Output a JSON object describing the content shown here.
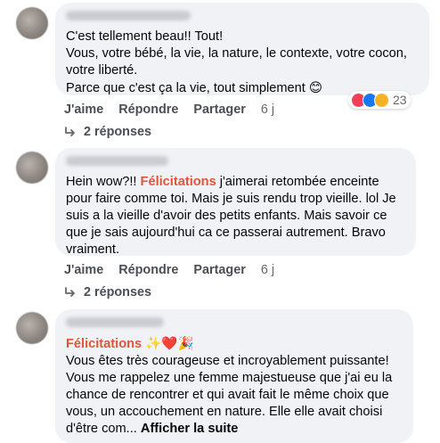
{
  "comments": [
    {
      "text": "C'est tellement beau!! Tout!\nVous, votre bébé, la vie, la nature, le contexte, votre cocon, votre liberté.\nParce que c'est ça la vie, tout simplement",
      "emoji": "😊",
      "reactions": {
        "icons": [
          "heart-reaction-icon",
          "like-reaction-icon",
          "care-reaction-icon"
        ],
        "count": "23"
      },
      "actions": {
        "like": "J'aime",
        "reply": "Répondre",
        "share": "Partager",
        "time": "6 j"
      },
      "replies": "2 réponses"
    },
    {
      "text_before": "Hein wow?!! ",
      "highlight": "Félicitations",
      "text_after": " j'aimerai retombée enceinte pour faire comme toi. Mais je suis rendu trop vieille. lol Je suis a la vieille d'avoir des petits enfants. Mais savoir ce que je sais aujourd'hui ca ce passerai autrement. Bravo vraiment.",
      "actions": {
        "like": "J'aime",
        "reply": "Répondre",
        "share": "Partager",
        "time": "6 j"
      },
      "replies": "2 réponses"
    },
    {
      "highlight": "Félicitations",
      "emoji": "✨❤️🎉",
      "text": "Vous êtes très courageuse et incroyablement puissante! Vous me rappelez une femme majestueuse que j'ai eu la chance de rencontrer et qui avait fait le même choix que vous, un accouchement en nature. Elle elle avait choisi d'être com...",
      "see_more": "Afficher la suite"
    }
  ],
  "colors": {
    "bubble": "#f0f2f5",
    "highlight": "#e0553a",
    "action": "#4a4e55",
    "meta": "#65676b"
  }
}
